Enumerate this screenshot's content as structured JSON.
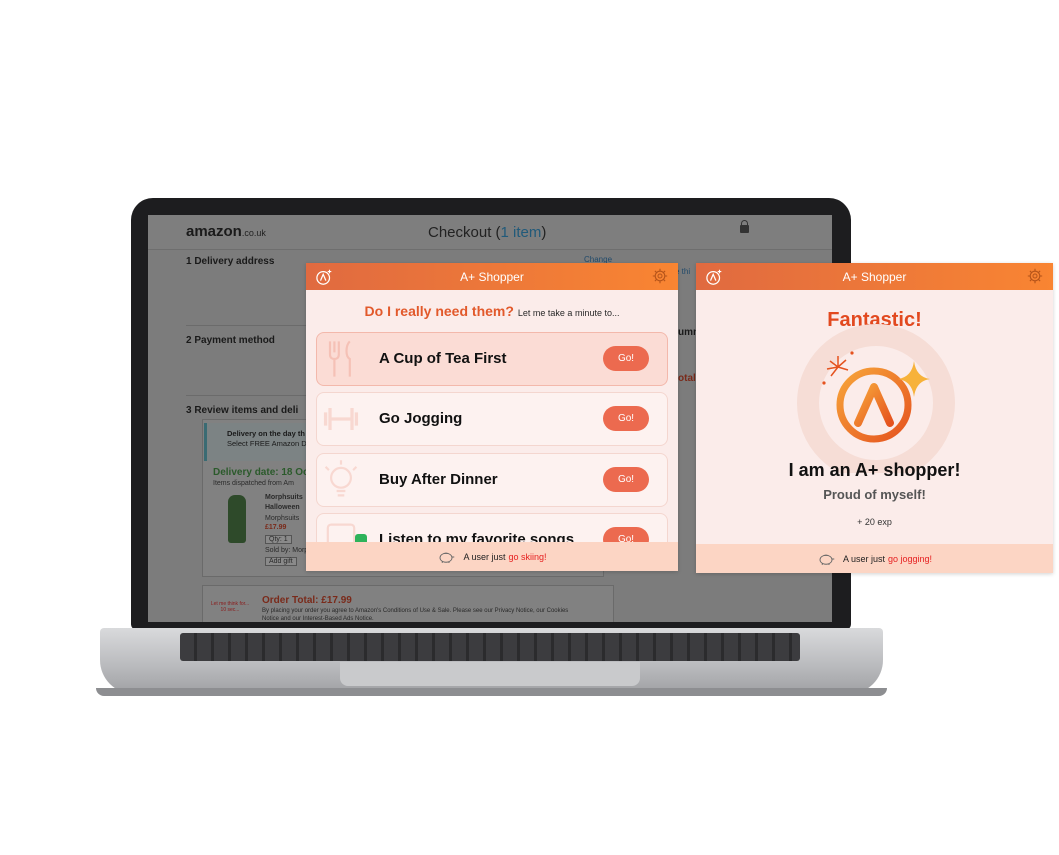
{
  "amazon": {
    "logo": "amazon",
    "logo_suffix": ".co.uk",
    "title": "Checkout (",
    "title_count": "1 item",
    "title_close": ")",
    "step1": "1   Delivery address",
    "step2": "2   Payment method",
    "step3": "3   Review items and deli",
    "change_link": "Change",
    "notice_line1": "Delivery on the day th",
    "notice_line2": "Select FREE Amazon Da",
    "delivery_date": "Delivery date: 18 Oc",
    "dispatched": "Items dispatched from Am",
    "product_name_1": "Morphsuits",
    "product_name_2": "Halloween",
    "product_brand": "Morphsuits",
    "product_price": "£17.99",
    "qty": "Qty: 1",
    "sold_by": "Sold by: Morp",
    "add_gift": "Add gift",
    "order_total": "Order Total: £17.99",
    "legal_line1": "By placing your order you agree to Amazon's Conditions of Use & Sale. Please see our Privacy Notice, our Cookies",
    "legal_line2": "Notice and our Interest-Based Ads Notice.",
    "let_me_think": "Let me think for... 10 sec...",
    "right_col_1": "e thi",
    "right_col_2": "umm",
    "right_col_3": "otal:"
  },
  "panel_a": {
    "title": "A+ Shopper",
    "question": "Do I really need them?",
    "question_sub": "Let me take a minute to...",
    "options": [
      {
        "label": "A Cup of Tea First",
        "button": "Go!",
        "icon": "fork-knife-icon"
      },
      {
        "label": "Go Jogging",
        "button": "Go!",
        "icon": "dumbbell-icon"
      },
      {
        "label": "Buy After Dinner",
        "button": "Go!",
        "icon": "lightbulb-icon"
      },
      {
        "label": "Listen to my favorite songs",
        "button": "Go!",
        "icon": "spotify-icon"
      }
    ],
    "footer_prefix": "A user just",
    "footer_action": "go skiing!"
  },
  "panel_b": {
    "title": "A+ Shopper",
    "headline": "Fantastic!",
    "statement": "I am an A+ shopper!",
    "sub": "Proud of myself!",
    "exp": "+ 20 exp",
    "footer_prefix": "A user just",
    "footer_action": "go jogging!"
  },
  "colors": {
    "accent": "#e2592b",
    "bar_start": "#e06a40",
    "bar_end": "#f98532",
    "go_button": "#ec6a4f",
    "footer_bg": "#fcd5c4",
    "panel_bg": "#fbecea"
  }
}
